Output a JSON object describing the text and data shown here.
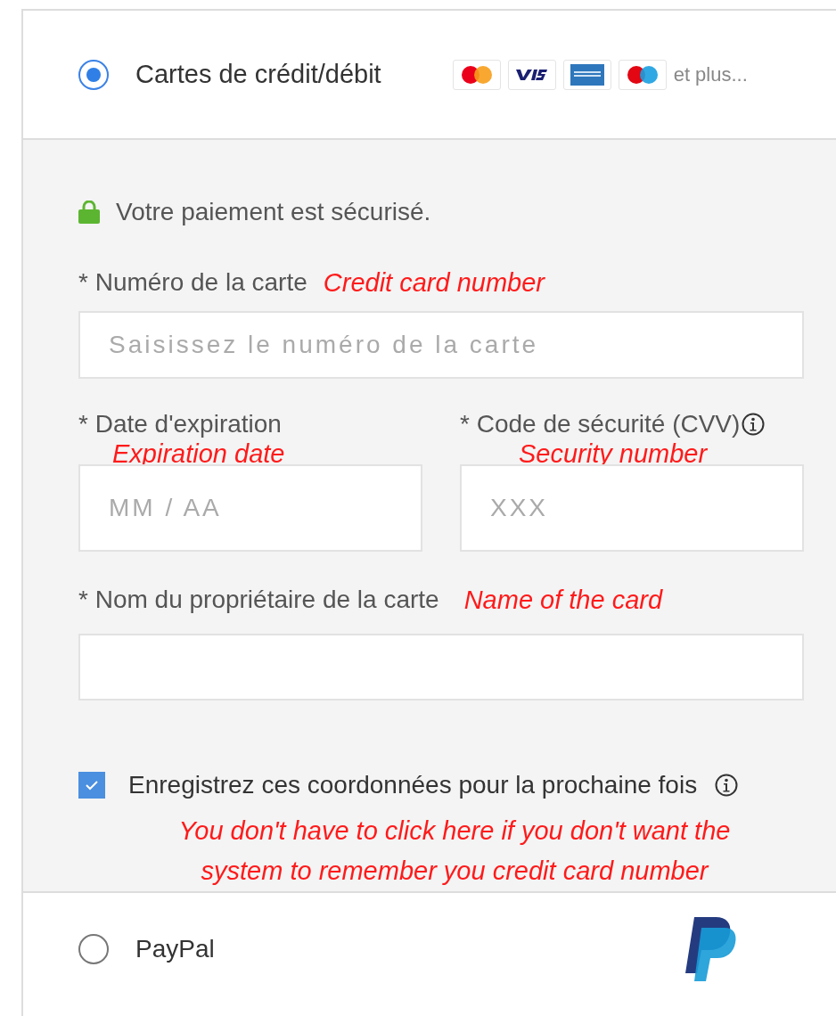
{
  "card_option": {
    "label": "Cartes de crédit/débit",
    "selected": true,
    "more_brands": "et plus..."
  },
  "secure_note": "Votre paiement est sécurisé.",
  "card_number": {
    "label": "* Numéro de la carte",
    "annotation": "Credit card number",
    "placeholder": "Saisissez le numéro de la carte"
  },
  "expiry": {
    "label": "* Date d'expiration",
    "annotation": "Expiration date",
    "placeholder": "MM / AA"
  },
  "security_code": {
    "label": "* Code de sécurité (CVV)",
    "annotation": "Security number",
    "placeholder": "XXX"
  },
  "cardholder": {
    "label": "* Nom du propriétaire de la carte",
    "annotation": "Name of the card"
  },
  "save_details": {
    "label": "Enregistrez ces coordonnées pour la prochaine fois",
    "checked": true,
    "annotation": "You don't have to click here if you don't want the system to remember you credit card number"
  },
  "paypal_option": {
    "label": "PayPal",
    "selected": false
  }
}
